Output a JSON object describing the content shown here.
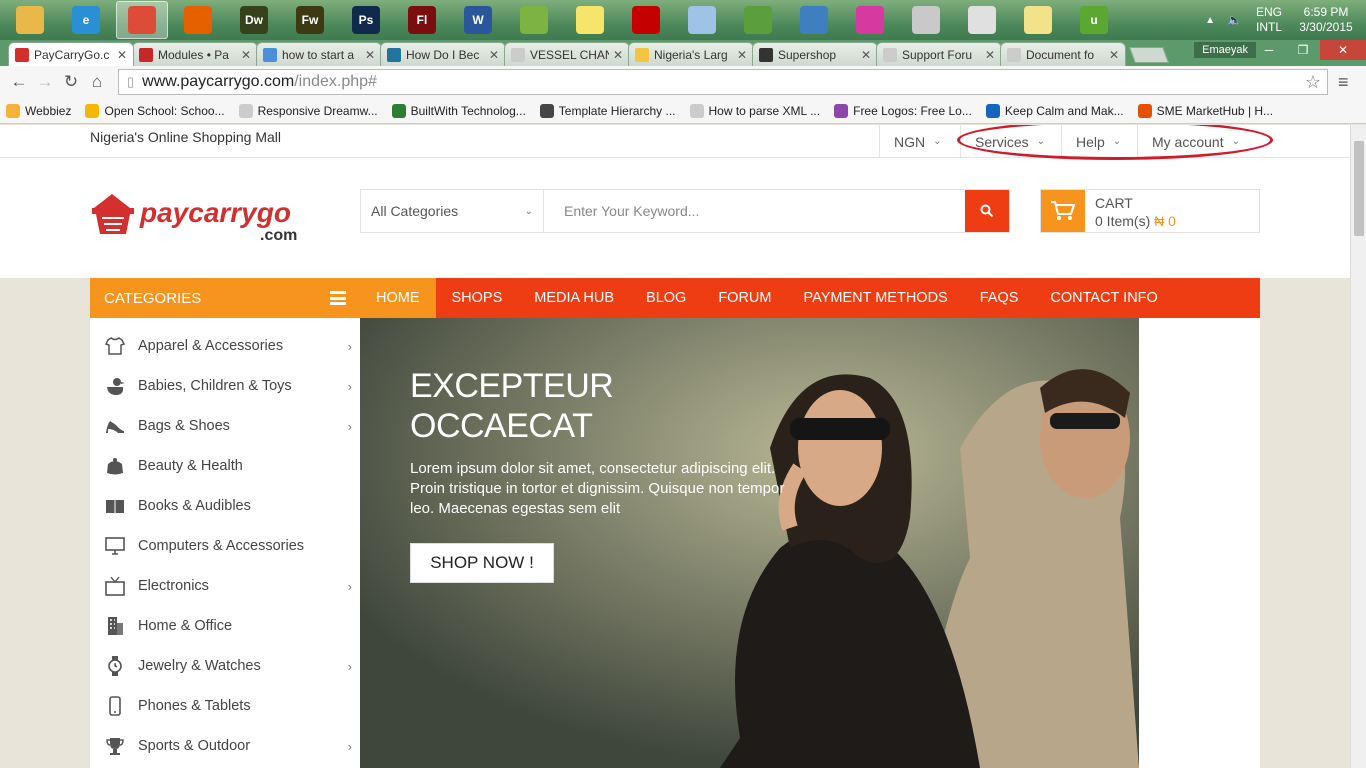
{
  "taskbar": {
    "apps": [
      {
        "name": "file-explorer-icon",
        "color": "#e8b84a",
        "label": ""
      },
      {
        "name": "internet-explorer-icon",
        "color": "#2b8fd6",
        "label": "e"
      },
      {
        "name": "chrome-icon",
        "color": "#dd4b39",
        "label": ""
      },
      {
        "name": "firefox-icon",
        "color": "#e66000",
        "label": ""
      },
      {
        "name": "dreamweaver-icon",
        "color": "#35421b",
        "label": "Dw"
      },
      {
        "name": "fireworks-icon",
        "color": "#3d3a13",
        "label": "Fw"
      },
      {
        "name": "photoshop-icon",
        "color": "#0f2a4a",
        "label": "Ps"
      },
      {
        "name": "flash-icon",
        "color": "#7a0d0d",
        "label": "Fl"
      },
      {
        "name": "word-icon",
        "color": "#2b579a",
        "label": "W"
      },
      {
        "name": "app-leaf-icon",
        "color": "#7cb342",
        "label": ""
      },
      {
        "name": "sticky-notes-icon",
        "color": "#f5e66b",
        "label": ""
      },
      {
        "name": "acrobat-icon",
        "color": "#c40000",
        "label": ""
      },
      {
        "name": "notepad-icon",
        "color": "#9ec3e6",
        "label": ""
      },
      {
        "name": "chart-editor-icon",
        "color": "#5b9e3e",
        "label": ""
      },
      {
        "name": "mail-icon",
        "color": "#3f7fbf",
        "label": ""
      },
      {
        "name": "app-pink-icon",
        "color": "#d63aa0",
        "label": ""
      },
      {
        "name": "cube-icon",
        "color": "#c9c9c9",
        "label": ""
      },
      {
        "name": "paint-icon",
        "color": "#e0e0e0",
        "label": ""
      },
      {
        "name": "notes-yellow-icon",
        "color": "#f2e38a",
        "label": ""
      },
      {
        "name": "utorrent-icon",
        "color": "#5aa832",
        "label": "u"
      }
    ],
    "lang_line1": "ENG",
    "lang_line2": "INTL",
    "time": "6:59 PM",
    "date": "3/30/2015"
  },
  "browser": {
    "tabs": [
      {
        "label": "PayCarryGo.c",
        "color": "#d32f2f",
        "active": true
      },
      {
        "label": "Modules • Pa",
        "color": "#c62828",
        "active": false
      },
      {
        "label": "how to start a",
        "color": "#4a90d9",
        "active": false
      },
      {
        "label": "How Do I Bec",
        "color": "#21759b",
        "active": false
      },
      {
        "label": "VESSEL CHAN",
        "color": "#cccccc",
        "active": false
      },
      {
        "label": "Nigeria's Larg",
        "color": "#f5c542",
        "active": false
      },
      {
        "label": "Supershop",
        "color": "#333333",
        "active": false
      },
      {
        "label": "Support Foru",
        "color": "#cccccc",
        "active": false
      },
      {
        "label": "Document fo",
        "color": "#cccccc",
        "active": false
      }
    ],
    "user": "Emaeyak",
    "url_host": "www.paycarrygo.com",
    "url_path": "/index.php#",
    "bookmarks": [
      {
        "label": "Webbiez",
        "color": "#f2b53a"
      },
      {
        "label": "Open School: Schoo...",
        "color": "#f5b800"
      },
      {
        "label": "Responsive Dreamw...",
        "color": "#cccccc"
      },
      {
        "label": "BuiltWith Technolog...",
        "color": "#2e7d32"
      },
      {
        "label": "Template Hierarchy ...",
        "color": "#464646"
      },
      {
        "label": "How to parse XML ...",
        "color": "#cccccc"
      },
      {
        "label": "Free Logos: Free Lo...",
        "color": "#8e44ad"
      },
      {
        "label": "Keep Calm and Mak...",
        "color": "#1565c0"
      },
      {
        "label": "SME MarketHub | H...",
        "color": "#e65100"
      }
    ]
  },
  "site": {
    "tagline": "Nigeria's Online Shopping Mall",
    "currency": "NGN",
    "services": "Services",
    "help": "Help",
    "my_account": "My account",
    "logo_main": "paycarrygo",
    "logo_sub": ".com",
    "search_category": "All Categories",
    "search_placeholder": "Enter Your Keyword...",
    "cart_title": "CART",
    "cart_items": "0 Item(s)",
    "cart_amount": "₦ 0",
    "categories_title": "CATEGORIES",
    "nav": [
      "HOME",
      "SHOPS",
      "MEDIA HUB",
      "BLOG",
      "FORUM",
      "PAYMENT METHODS",
      "FAQS",
      "CONTACT INFO"
    ],
    "categories": [
      {
        "label": "Apparel & Accessories",
        "icon": "shirt-icon",
        "arrow": true
      },
      {
        "label": "Babies, Children & Toys",
        "icon": "duck-toy-icon",
        "arrow": true
      },
      {
        "label": "Bags & Shoes",
        "icon": "high-heel-icon",
        "arrow": true
      },
      {
        "label": "Beauty & Health",
        "icon": "beauty-bag-icon",
        "arrow": false
      },
      {
        "label": "Books & Audibles",
        "icon": "book-icon",
        "arrow": false
      },
      {
        "label": "Computers & Accessories",
        "icon": "monitor-icon",
        "arrow": false
      },
      {
        "label": "Electronics",
        "icon": "tv-icon",
        "arrow": true
      },
      {
        "label": "Home & Office",
        "icon": "building-icon",
        "arrow": false
      },
      {
        "label": "Jewelry & Watches",
        "icon": "watch-icon",
        "arrow": true
      },
      {
        "label": "Phones & Tablets",
        "icon": "phone-icon",
        "arrow": false
      },
      {
        "label": "Sports & Outdoor",
        "icon": "trophy-icon",
        "arrow": true
      }
    ],
    "hero_title_1": "EXCEPTEUR",
    "hero_title_2": "OCCAECAT",
    "hero_text": "Lorem ipsum dolor sit amet, consectetur adipiscing elit. Proin tristique in tortor et dignissim. Quisque non tempor leo. Maecenas egestas sem elit",
    "hero_button": "SHOP NOW !"
  },
  "colors": {
    "brand_red": "#ee3d12",
    "brand_orange": "#f7941d",
    "annotation": "#d11b2b"
  }
}
